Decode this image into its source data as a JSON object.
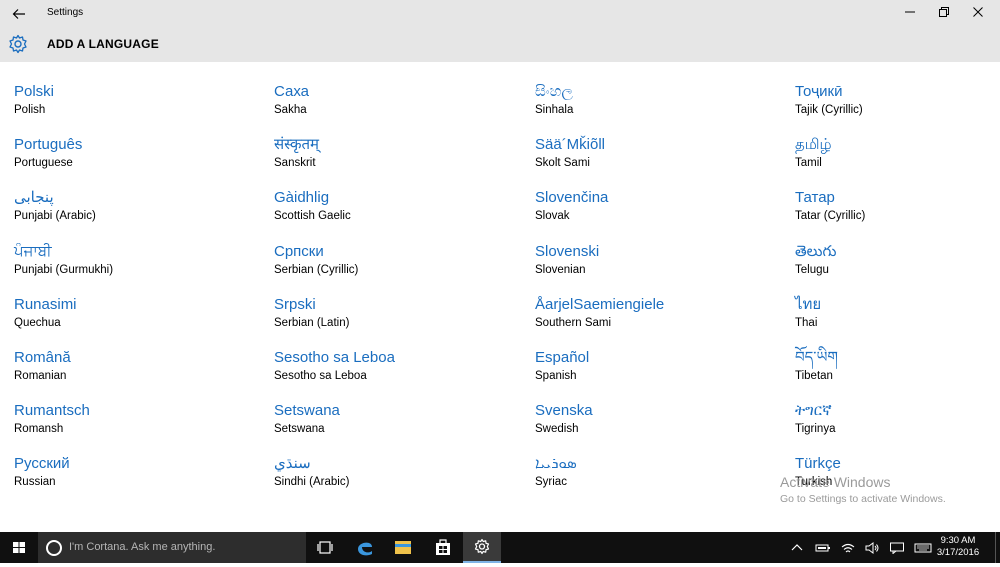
{
  "window": {
    "title": "Settings",
    "minimize": "—",
    "maximize": "⧉",
    "close": "✕"
  },
  "header": {
    "title": "ADD A LANGUAGE",
    "icon": "gear-icon"
  },
  "languages": [
    [
      {
        "native": "Polski",
        "english": "Polish"
      },
      {
        "native": "Português",
        "english": "Portuguese"
      },
      {
        "native": "پنجابی",
        "english": "Punjabi (Arabic)"
      },
      {
        "native": "ਪੰਜਾਬੀ",
        "english": "Punjabi (Gurmukhi)"
      },
      {
        "native": "Runasimi",
        "english": "Quechua"
      },
      {
        "native": "Română",
        "english": "Romanian"
      },
      {
        "native": "Rumantsch",
        "english": "Romansh"
      },
      {
        "native": "Русский",
        "english": "Russian"
      }
    ],
    [
      {
        "native": "Саха",
        "english": "Sakha"
      },
      {
        "native": "संस्कृतम्",
        "english": "Sanskrit"
      },
      {
        "native": "Gàidhlig",
        "english": "Scottish Gaelic"
      },
      {
        "native": "Српски",
        "english": "Serbian (Cyrillic)"
      },
      {
        "native": "Srpski",
        "english": "Serbian (Latin)"
      },
      {
        "native": "Sesotho sa Leboa",
        "english": "Sesotho sa Leboa"
      },
      {
        "native": "Setswana",
        "english": "Setswana"
      },
      {
        "native": "سنڌي",
        "english": "Sindhi (Arabic)"
      }
    ],
    [
      {
        "native": "සිංහල",
        "english": "Sinhala"
      },
      {
        "native": "Sää´Mǩiõll",
        "english": "Skolt Sami"
      },
      {
        "native": "Slovenčina",
        "english": "Slovak"
      },
      {
        "native": "Slovenski",
        "english": "Slovenian"
      },
      {
        "native": "ÅarjelSaemiengiele",
        "english": "Southern Sami"
      },
      {
        "native": "Español",
        "english": "Spanish"
      },
      {
        "native": "Svenska",
        "english": "Swedish"
      },
      {
        "native": "ܣܘܪܝܝܐ",
        "english": "Syriac"
      }
    ],
    [
      {
        "native": "Тоҷикӣ",
        "english": "Tajik (Cyrillic)"
      },
      {
        "native": "தமிழ்",
        "english": "Tamil"
      },
      {
        "native": "Татар",
        "english": "Tatar (Cyrillic)"
      },
      {
        "native": "తెలుగు",
        "english": "Telugu"
      },
      {
        "native": "ไทย",
        "english": "Thai"
      },
      {
        "native": "བོད་ཡིག",
        "english": "Tibetan"
      },
      {
        "native": "ትግርኛ",
        "english": "Tigrinya"
      },
      {
        "native": "Türkçe",
        "english": "Turkish"
      }
    ]
  ],
  "watermark": {
    "line1": "Activate Windows",
    "line2": "Go to Settings to activate Windows."
  },
  "taskbar": {
    "cortana_placeholder": "I'm Cortana. Ask me anything.",
    "time": "9:30 AM",
    "date": "3/17/2016"
  },
  "colors": {
    "accent": "#1a6dbf",
    "titlebar": "#e6e6e6",
    "taskbar": "#101010"
  }
}
